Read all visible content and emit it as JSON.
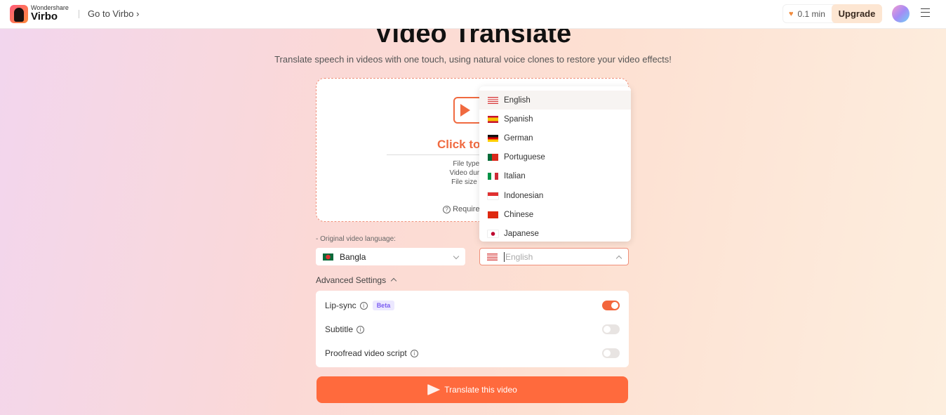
{
  "header": {
    "brand_small": "Wondershare",
    "brand": "Virbo",
    "goto": "Go to Virbo",
    "credit": "0.1 min",
    "upgrade": "Upgrade"
  },
  "title": "Video Translate",
  "subtitle": "Translate speech in videos with one touch, using natural voice clones to restore your video effects!",
  "upload": {
    "title": "Click to uplo",
    "info": [
      "File type: mp",
      "Video duration:",
      "File size up to"
    ],
    "requirements": "Require"
  },
  "original_language": {
    "label": "- Original video language:",
    "value": "Bangla"
  },
  "target_language": {
    "value": "English"
  },
  "dropdown": [
    {
      "label": "English",
      "flag": "us"
    },
    {
      "label": "Spanish",
      "flag": "es"
    },
    {
      "label": "German",
      "flag": "de"
    },
    {
      "label": "Portuguese",
      "flag": "pt"
    },
    {
      "label": "Italian",
      "flag": "it"
    },
    {
      "label": "Indonesian",
      "flag": "id"
    },
    {
      "label": "Chinese",
      "flag": "cn"
    },
    {
      "label": "Japanese",
      "flag": "jp"
    }
  ],
  "advanced": {
    "label": "Advanced Settings",
    "items": [
      {
        "label": "Lip-sync",
        "badge": "Beta",
        "on": true
      },
      {
        "label": "Subtitle",
        "on": false
      },
      {
        "label": "Proofread video script",
        "on": false
      }
    ]
  },
  "cta": "Translate this video",
  "colors": {
    "accent": "#ff6a3d"
  }
}
